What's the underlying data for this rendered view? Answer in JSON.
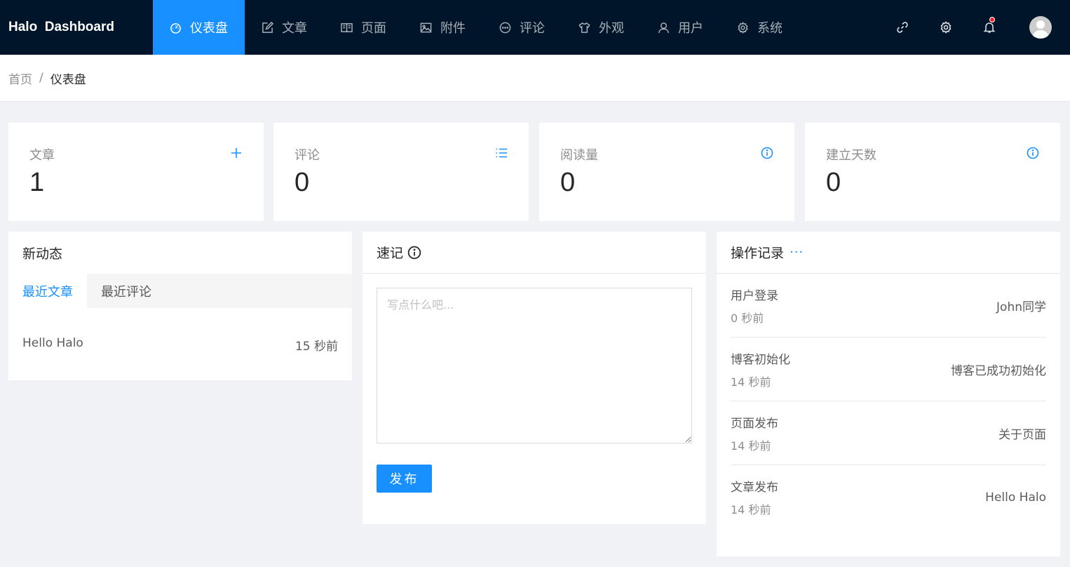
{
  "app": {
    "logo": "Halo  Dashboard"
  },
  "nav": {
    "items": [
      {
        "label": "仪表盘",
        "icon": "dashboard-icon",
        "active": true
      },
      {
        "label": "文章",
        "icon": "edit-icon"
      },
      {
        "label": "页面",
        "icon": "book-icon"
      },
      {
        "label": "附件",
        "icon": "picture-icon"
      },
      {
        "label": "评论",
        "icon": "message-icon"
      },
      {
        "label": "外观",
        "icon": "skin-icon"
      },
      {
        "label": "用户",
        "icon": "user-icon"
      },
      {
        "label": "系统",
        "icon": "setting-icon"
      }
    ]
  },
  "breadcrumb": {
    "home": "首页",
    "separator": "/",
    "current": "仪表盘"
  },
  "stats": [
    {
      "title": "文章",
      "value": "1",
      "icon": "plus-icon"
    },
    {
      "title": "评论",
      "value": "0",
      "icon": "list-icon"
    },
    {
      "title": "阅读量",
      "value": "0",
      "icon": "info-icon"
    },
    {
      "title": "建立天数",
      "value": "0",
      "icon": "info-icon"
    }
  ],
  "activity": {
    "title": "新动态",
    "tabs": [
      "最近文章",
      "最近评论"
    ],
    "posts": [
      {
        "title": "Hello Halo",
        "time": "15 秒前"
      }
    ]
  },
  "memo": {
    "title": "速记",
    "placeholder": "写点什么吧...",
    "publish": "发布"
  },
  "logs": {
    "title": "操作记录",
    "more": "···",
    "items": [
      {
        "title": "用户登录",
        "time": "0 秒前",
        "content": "John同学"
      },
      {
        "title": "博客初始化",
        "time": "14 秒前",
        "content": "博客已成功初始化"
      },
      {
        "title": "页面发布",
        "time": "14 秒前",
        "content": "关于页面"
      },
      {
        "title": "文章发布",
        "time": "14 秒前",
        "content": "Hello Halo"
      }
    ]
  },
  "colors": {
    "primary": "#1890ff",
    "header": "#001529",
    "background": "#f0f2f5"
  }
}
